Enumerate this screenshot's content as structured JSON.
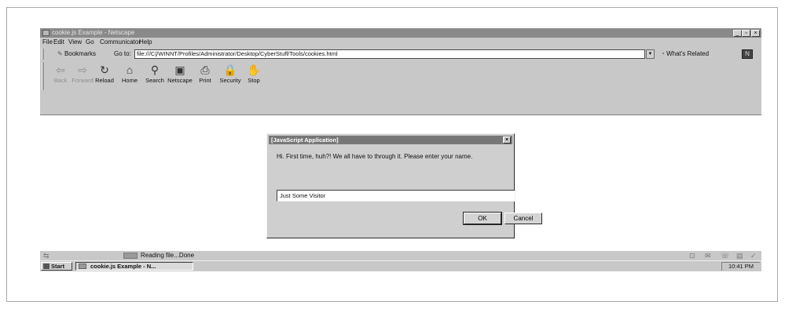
{
  "window": {
    "title": "cookie.js Example - Netscape",
    "controls": {
      "minimize": "_",
      "maximize": "▫",
      "close": "×"
    }
  },
  "menubar": [
    "File",
    "Edit",
    "View",
    "Go",
    "Communicator",
    "Help"
  ],
  "location": {
    "bookmarks_label": "Bookmarks",
    "goto_label": "Go to:",
    "url": "file:///C|/WINNT/Profiles/Administrator/Desktop/CyberStuff/Tools/cookies.html",
    "whats_related_label": "What's Related"
  },
  "toolbar": [
    {
      "label": "Back",
      "icon": "back-arrow-icon",
      "glyph": "⇦",
      "enabled": false
    },
    {
      "label": "Forward",
      "icon": "forward-arrow-icon",
      "glyph": "⇨",
      "enabled": false
    },
    {
      "label": "Reload",
      "icon": "reload-icon",
      "glyph": "↻",
      "enabled": true
    },
    {
      "label": "Home",
      "icon": "home-icon",
      "glyph": "⌂",
      "enabled": true
    },
    {
      "label": "Search",
      "icon": "search-icon",
      "glyph": "⚲",
      "enabled": true
    },
    {
      "label": "Netscape",
      "icon": "netscape-icon",
      "glyph": "▣",
      "enabled": true
    },
    {
      "label": "Print",
      "icon": "print-icon",
      "glyph": "⎙",
      "enabled": true
    },
    {
      "label": "Security",
      "icon": "security-lock-icon",
      "glyph": "🔒",
      "enabled": true
    },
    {
      "label": "Stop",
      "icon": "stop-icon",
      "glyph": "✋",
      "enabled": true
    }
  ],
  "dialog": {
    "title": "[JavaScript Application]",
    "message": "Hi.  First time, huh?! We all have to  through it. Please enter your name.",
    "input_value": "Just Some Visitor",
    "ok_label": "OK",
    "cancel_label": "Cancel"
  },
  "status": {
    "text": "Reading file...Done"
  },
  "taskbar": {
    "start_label": "Start",
    "task_label": "cookie.js Example - N...",
    "clock": "10:41 PM"
  }
}
